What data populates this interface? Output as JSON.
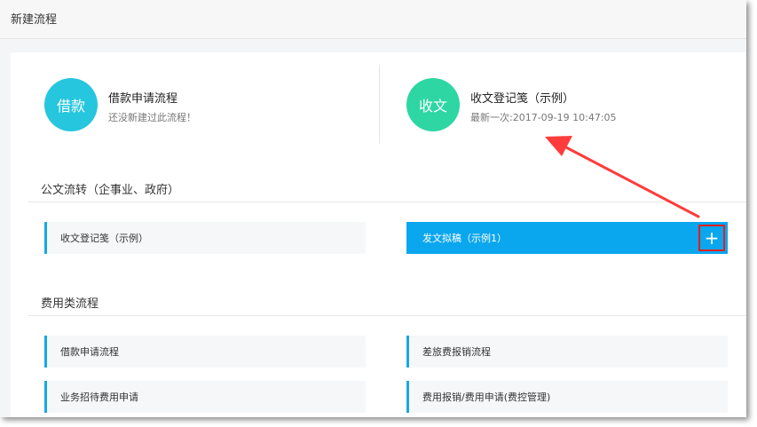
{
  "page": {
    "title": "新建流程"
  },
  "recent": [
    {
      "icon_text": "借款",
      "icon_color": "#25c6de",
      "name": "借款申请流程",
      "subtitle": "还没新建过此流程！"
    },
    {
      "icon_text": "收文",
      "icon_color": "#2dd6a3",
      "name": "收文登记笺（示例）",
      "subtitle": "最新一次:2017-09-19 10:47:05"
    }
  ],
  "sections": [
    {
      "title": "公文流转（企事业、政府）",
      "items": [
        {
          "label": "收文登记笺（示例）"
        },
        {
          "label": "发文拟稿（示例1）",
          "action": "+"
        }
      ]
    },
    {
      "title": "费用类流程",
      "items": [
        {
          "label": "借款申请流程"
        },
        {
          "label": "差旅费报销流程"
        },
        {
          "label": "业务招待费用申请"
        },
        {
          "label": "费用报销/费用申请(费控管理)"
        }
      ]
    }
  ],
  "colors": {
    "accent": "#0aa6ee",
    "highlight": "#e02020"
  }
}
